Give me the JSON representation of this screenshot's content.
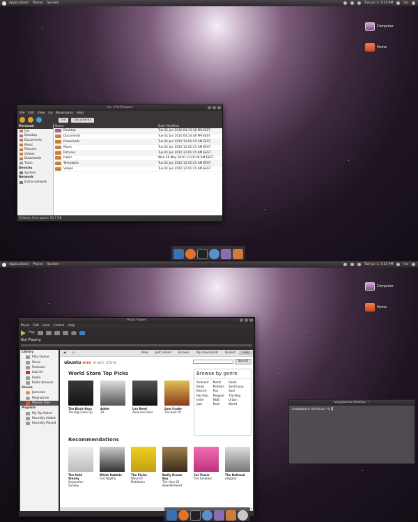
{
  "screenshot1": {
    "panel": {
      "menus": [
        "Applications",
        "Places",
        "System"
      ],
      "user": "ivo",
      "clock": "Tue Jun 1, 4:14 PM"
    },
    "desktop_icons": [
      {
        "label": "Computer"
      },
      {
        "label": "Home"
      }
    ],
    "file_manager": {
      "title": "ivo - File Browser",
      "menus": [
        "File",
        "Edit",
        "View",
        "Go",
        "Bookmarks",
        "Help"
      ],
      "breadcrumbs": [
        "ivo",
        "Documents"
      ],
      "sidebar": {
        "personal_header": "Personal",
        "personal": [
          "ivo",
          "Desktop",
          "Documents",
          "Music",
          "Pictures",
          "Videos",
          "Downloads",
          "Trash"
        ],
        "devices_header": "Devices",
        "devices": [
          "System"
        ],
        "network_header": "Network",
        "network": [
          "Entire network"
        ]
      },
      "columns": [
        "Name",
        "Date Modified"
      ],
      "rows": [
        {
          "name": "Desktop",
          "date": "Tue 01 Jun 2010 04:13:18 PM EEST"
        },
        {
          "name": "Documents",
          "date": "Tue 01 Jun 2010 04:14:48 PM EEST"
        },
        {
          "name": "Downloads",
          "date": "Tue 01 Jun 2010 12:01:25 AM EEST"
        },
        {
          "name": "Music",
          "date": "Tue 01 Jun 2010 12:01:25 AM EEST"
        },
        {
          "name": "Pictures",
          "date": "Tue 01 Jun 2010 12:01:25 AM EEST"
        },
        {
          "name": "Public",
          "date": "Wed 26 May 2010 11:29:38 AM EEST"
        },
        {
          "name": "Templates",
          "date": "Tue 01 Jun 2010 12:01:25 AM EEST"
        },
        {
          "name": "Videos",
          "date": "Tue 01 Jun 2010 12:01:25 AM EEST"
        }
      ],
      "status": "8 items, Free space: 93.7 GB"
    }
  },
  "screenshot2": {
    "panel": {
      "menus": [
        "Applications",
        "Places",
        "System"
      ],
      "user": "ivo",
      "clock": "Tue Jun 1, 4:25 PM"
    },
    "desktop_icons": [
      {
        "label": "Computer"
      },
      {
        "label": "Home"
      }
    ],
    "rhythmbox": {
      "title": "Music Player",
      "menus": [
        "Music",
        "Edit",
        "View",
        "Control",
        "Help"
      ],
      "play_label": "Play",
      "now_playing": "Not Playing",
      "library_header": "Library",
      "library": [
        "Play Queue",
        "Music",
        "Podcasts",
        "Last.fm",
        "Radio",
        "Radio browser"
      ],
      "stores_header": "Stores",
      "stores": [
        "Jamendo",
        "Magnatune",
        "Ubuntu One"
      ],
      "playlists_header": "Playlists",
      "playlists": [
        "My Top Rated",
        "Recently Added",
        "Recently Played"
      ],
      "store": {
        "nav": [
          "New",
          "Just added",
          "Browse",
          "My downloads",
          "Basket",
          "Help"
        ],
        "brand_ubuntu": "ubuntu",
        "brand_one": "one",
        "brand_rest": "music store",
        "search_button": "Search",
        "top_picks_title": "World Store Top Picks",
        "top_picks": [
          {
            "artist": "The Black Keys",
            "album": "The Big Come Up"
          },
          {
            "artist": "Adele",
            "album": "19"
          },
          {
            "artist": "Lou Reed",
            "album": "American Poet"
          },
          {
            "artist": "Sam Cooke",
            "album": "The Best Of"
          }
        ],
        "genre_title": "Browse by genre",
        "genres": [
          [
            "Ambient",
            "Blues",
            "Electro",
            "Hip-Hop",
            "Indie",
            "Jazz"
          ],
          [
            "Metal",
            "Motown",
            "Pop",
            "Reggae",
            "R&B",
            "Rock"
          ],
          [
            "Roots",
            "Synth-pop",
            "Soul",
            "Trip-Hop",
            "Urban",
            "World"
          ]
        ],
        "recommendations_title": "Recommendations",
        "recommendations": [
          {
            "artist": "The Hold Steady",
            "album": "Separation Sunday"
          },
          {
            "artist": "White Rabbits",
            "album": "Fort Nightly"
          },
          {
            "artist": "The Pixies",
            "album": "Wave Of Mutilation"
          },
          {
            "artist": "Badly Drawn Boy",
            "album": "The Hour Of Bewilderbeast"
          },
          {
            "artist": "Cat Power",
            "album": "The Greatest"
          },
          {
            "artist": "The National",
            "album": "Alligator"
          }
        ]
      }
    },
    "terminal": {
      "title": "ivo@ubuntu-desktop: ~",
      "prompt": "ivo@ubuntu-desktop:~$"
    }
  }
}
